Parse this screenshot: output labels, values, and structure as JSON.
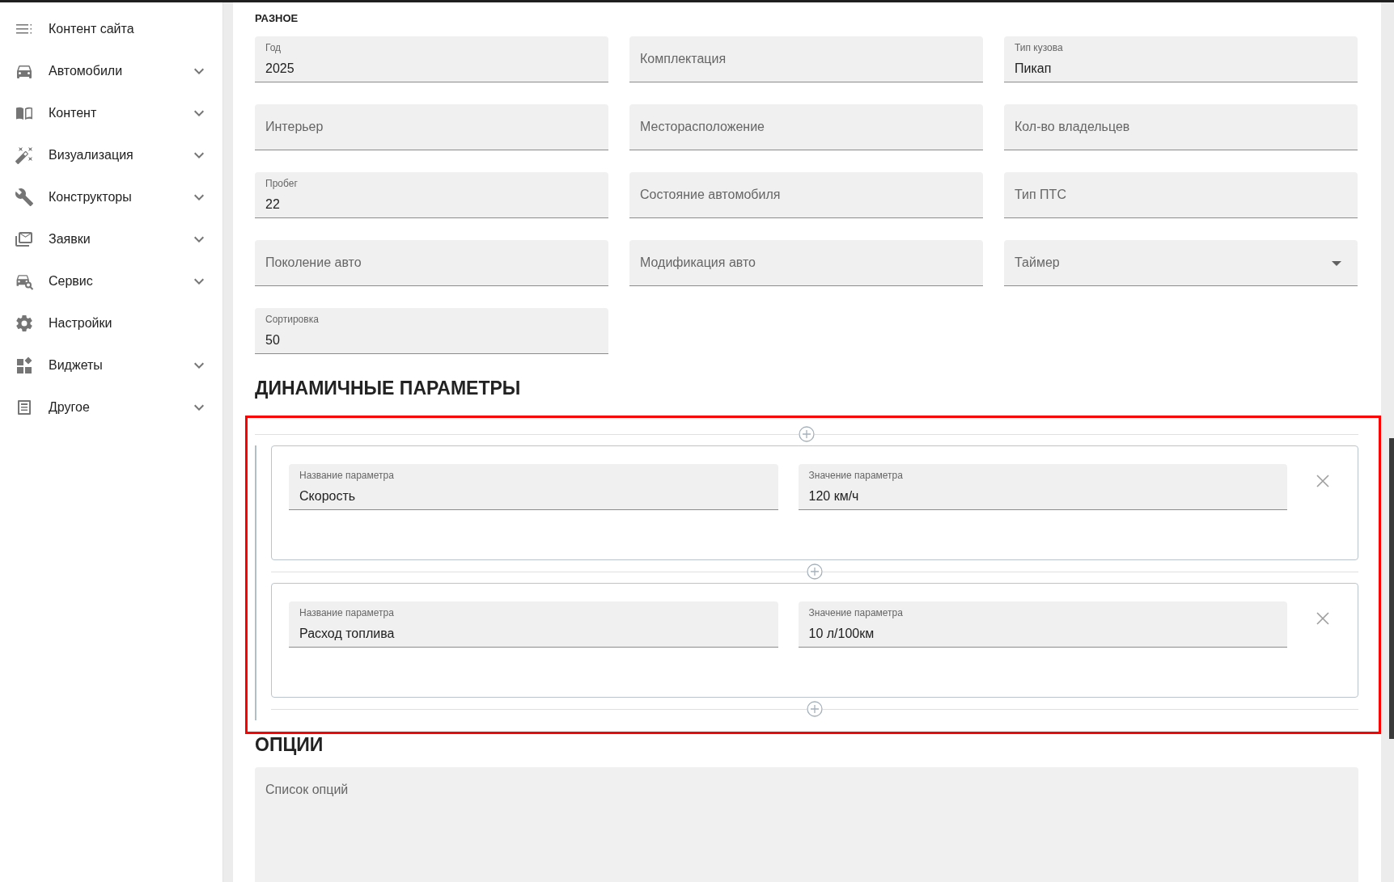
{
  "sidebar": {
    "items": [
      {
        "label": "Контент сайта",
        "submenu": false
      },
      {
        "label": "Автомобили",
        "submenu": true
      },
      {
        "label": "Контент",
        "submenu": true
      },
      {
        "label": "Визуализация",
        "submenu": true
      },
      {
        "label": "Конструкторы",
        "submenu": true
      },
      {
        "label": "Заявки",
        "submenu": true
      },
      {
        "label": "Сервис",
        "submenu": true
      },
      {
        "label": "Настройки",
        "submenu": false
      },
      {
        "label": "Виджеты",
        "submenu": true
      },
      {
        "label": "Другое",
        "submenu": true
      }
    ]
  },
  "misc": {
    "title": "РАЗНОЕ",
    "fields": [
      {
        "kind": "text",
        "label": "Год",
        "value": "2025"
      },
      {
        "kind": "text",
        "label": "Комплектация"
      },
      {
        "kind": "text",
        "label": "Тип кузова",
        "value": "Пикап"
      },
      {
        "kind": "text",
        "label": "Интерьер"
      },
      {
        "kind": "text",
        "label": "Месторасположение"
      },
      {
        "kind": "text",
        "label": "Кол-во владельцев"
      },
      {
        "kind": "text",
        "label": "Пробег",
        "value": "22"
      },
      {
        "kind": "text",
        "label": "Состояние автомобиля"
      },
      {
        "kind": "text",
        "label": "Тип ПТС"
      },
      {
        "kind": "text",
        "label": "Поколение авто"
      },
      {
        "kind": "text",
        "label": "Модификация авто"
      },
      {
        "kind": "select",
        "label": "Таймер"
      },
      {
        "kind": "text",
        "label": "Сортировка",
        "value": "50"
      }
    ]
  },
  "dynamic_params": {
    "title": "ДИНАМИЧНЫЕ ПАРАМЕТРЫ",
    "highlighted": true,
    "items": [
      {
        "fields": [
          {
            "label": "Название параметра",
            "value": "Скорость"
          },
          {
            "label": "Значение параметра",
            "value": "120 км/ч"
          }
        ]
      },
      {
        "fields": [
          {
            "label": "Название параметра",
            "value": "Расход топлива"
          },
          {
            "label": "Значение параметра",
            "value": "10 л/100км"
          }
        ]
      }
    ]
  },
  "options": {
    "title": "ОПЦИИ",
    "label": "Список опций"
  }
}
